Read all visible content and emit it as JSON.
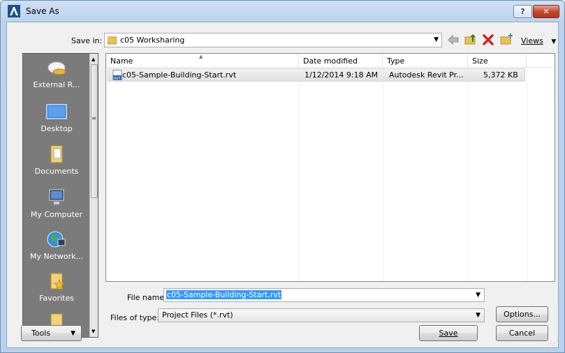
{
  "window": {
    "title": "Save As",
    "help_label": "?",
    "close_label": "✕"
  },
  "toolbar": {
    "save_in_label": "Save in:",
    "save_in_value": "c05 Worksharing",
    "views_label": "Views"
  },
  "places": [
    {
      "label": "External R...",
      "icon": "cloud-drive-icon"
    },
    {
      "label": "Desktop",
      "icon": "desktop-icon"
    },
    {
      "label": "Documents",
      "icon": "documents-icon"
    },
    {
      "label": "My Computer",
      "icon": "computer-icon"
    },
    {
      "label": "My Network...",
      "icon": "network-icon"
    },
    {
      "label": "Favorites",
      "icon": "favorites-folder-icon"
    }
  ],
  "file_list": {
    "columns": [
      "Name",
      "Date modified",
      "Type",
      "Size"
    ],
    "rows": [
      {
        "name": "c05-Sample-Building-Start.rvt",
        "date_modified": "1/12/2014 9:18 AM",
        "type": "Autodesk Revit Pr...",
        "size": "5,372 KB",
        "icon": "revit-file-icon"
      }
    ]
  },
  "form": {
    "file_name_label": "File name:",
    "file_name_value": "c05-Sample-Building-Start.rvt",
    "file_type_label": "Files of type:",
    "file_type_value": "Project Files  (*.rvt)"
  },
  "buttons": {
    "options": "Options...",
    "tools": "Tools",
    "save": "Save",
    "cancel": "Cancel"
  },
  "colors": {
    "selection": "#3399ff",
    "places_bg": "#7b7b7b",
    "close_button": "#c7492c"
  }
}
